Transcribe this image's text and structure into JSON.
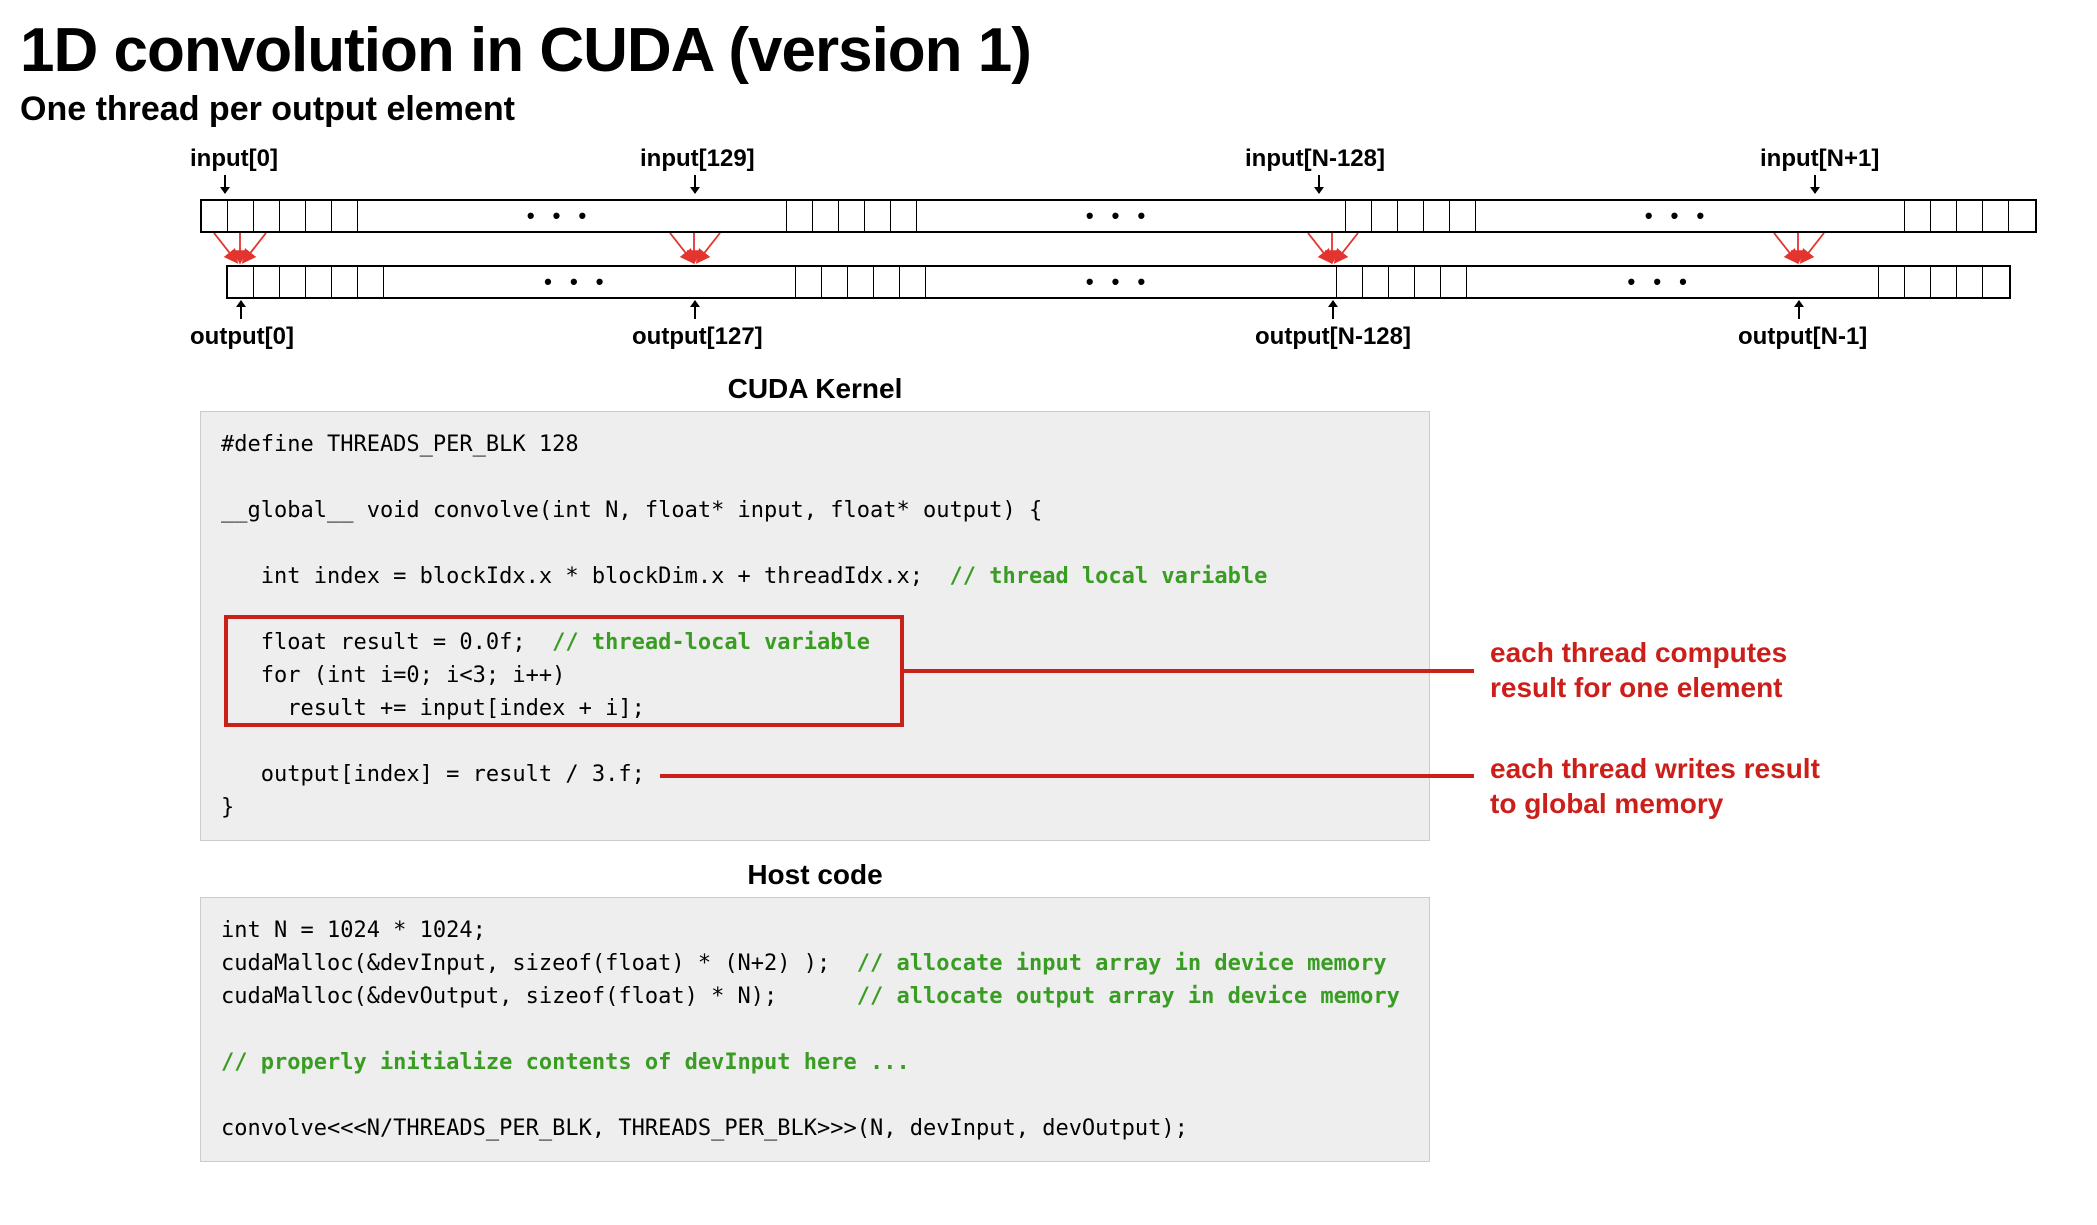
{
  "title": "1D convolution in CUDA (version 1)",
  "subtitle": "One thread per output element",
  "labels": {
    "in0": "input[0]",
    "in129": "input[129]",
    "inNm128": "input[N-128]",
    "inNp1": "input[N+1]",
    "out0": "output[0]",
    "out127": "output[127]",
    "outNm128": "output[N-128]",
    "outNm1": "output[N-1]",
    "ell": "• • •"
  },
  "sections": {
    "kernel": "CUDA Kernel",
    "host": "Host code"
  },
  "kernel_code": {
    "l1": "#define THREADS_PER_BLK 128",
    "l2": "",
    "l3": "__global__ void convolve(int N, float* input, float* output) {",
    "l4": "",
    "l5a": "   int index = blockIdx.x * blockDim.x + threadIdx.x;  ",
    "l5c": "// thread local variable",
    "l6": "",
    "l7a": "   float result = 0.0f;  ",
    "l7c": "// thread-local variable",
    "l8": "   for (int i=0; i<3; i++)",
    "l9": "     result += input[index + i];",
    "l10": "",
    "l11": "   output[index] = result / 3.f;",
    "l12": "}"
  },
  "host_code": {
    "l1": "int N = 1024 * 1024;",
    "l2a": "cudaMalloc(&devInput, sizeof(float) * (N+2) );  ",
    "l2c": "// allocate input array in device memory",
    "l3a": "cudaMalloc(&devOutput, sizeof(float) * N);      ",
    "l3c": "// allocate output array in device memory",
    "l4": "",
    "l5c": "// properly initialize contents of devInput here ...",
    "l6": "",
    "l7": "convolve<<<N/THREADS_PER_BLK, THREADS_PER_BLK>>>(N, devInput, devOutput);"
  },
  "annotations": {
    "a1l1": "each thread computes",
    "a1l2": "result for one element",
    "a2l1": "each thread writes result",
    "a2l2": "to global memory"
  }
}
